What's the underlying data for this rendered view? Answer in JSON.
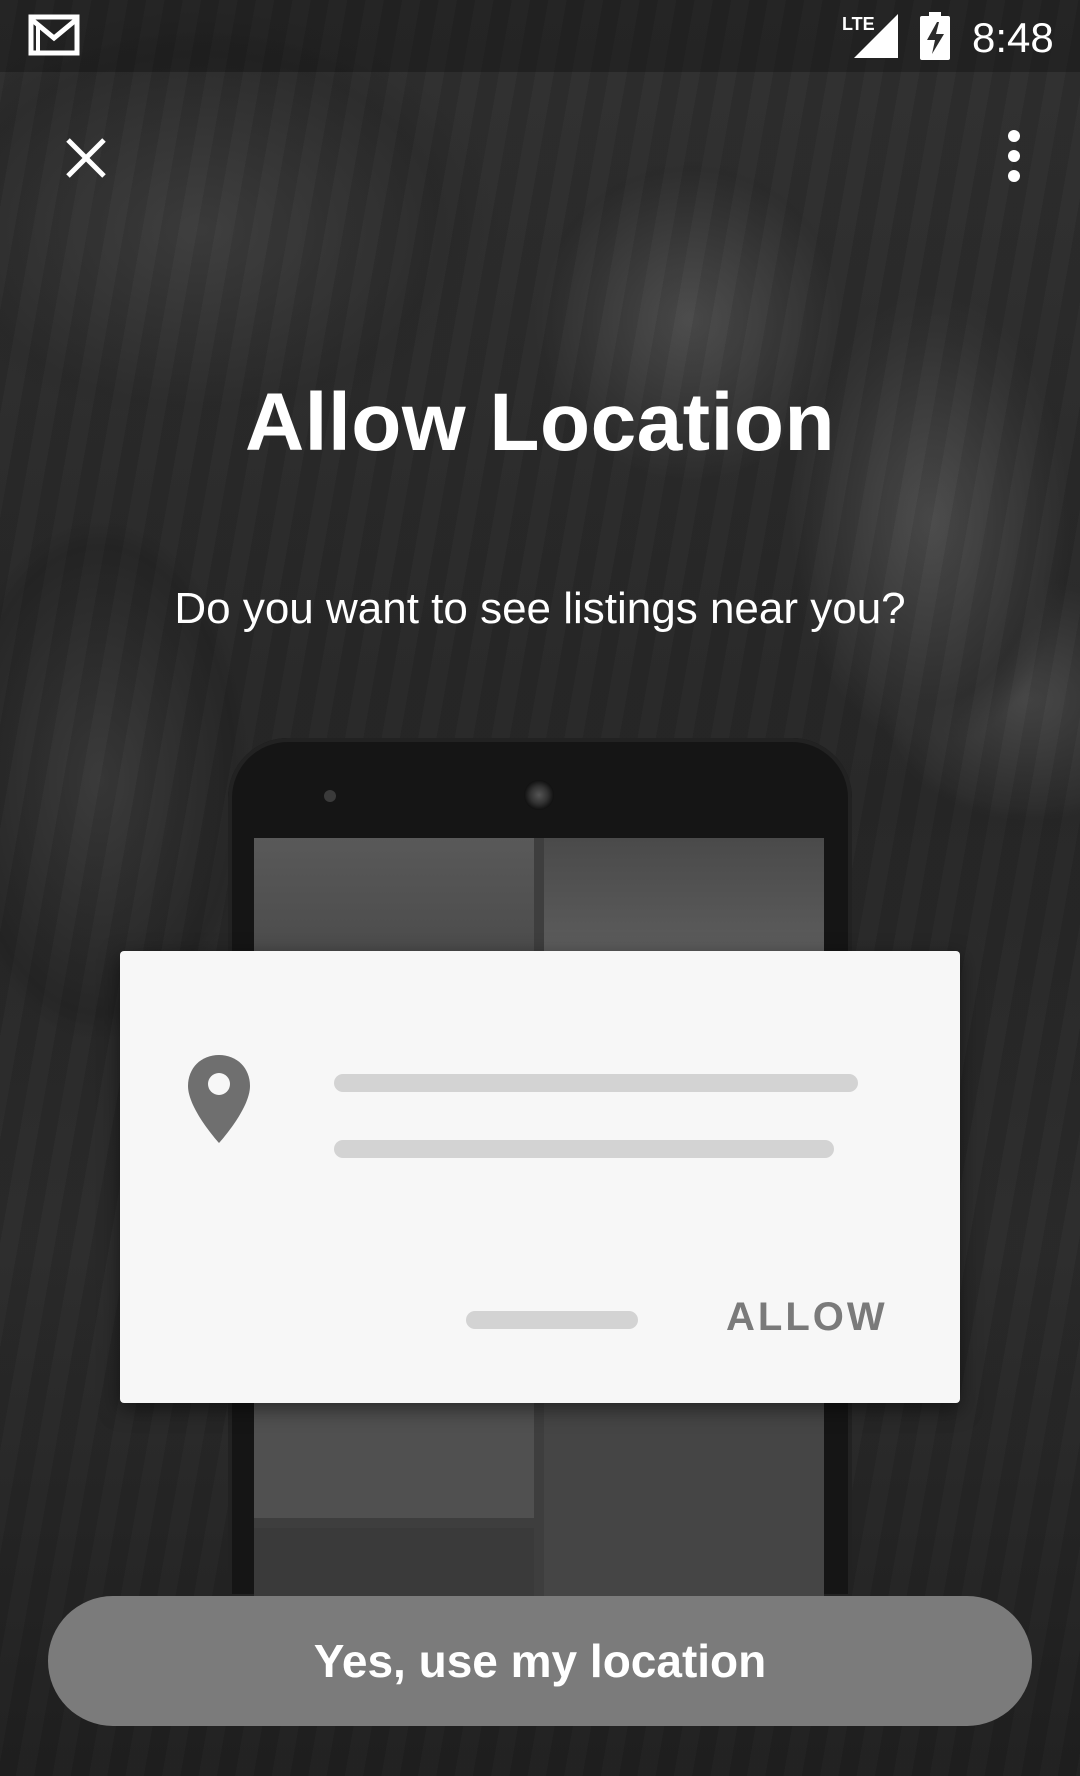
{
  "status_bar": {
    "time": "8:48",
    "network_label": "LTE",
    "icons": [
      "gmail-icon",
      "lte-signal-icon",
      "battery-charging-icon"
    ]
  },
  "toolbar": {
    "icons": [
      "close-icon",
      "more-vert-icon"
    ]
  },
  "title": "Allow Location",
  "subtitle": "Do you want to see listings near you?",
  "illustration": {
    "dialog_action_label": "ALLOW",
    "dialog_icon": "location-pin-icon"
  },
  "primary_button": {
    "label": "Yes, use my location"
  },
  "colors": {
    "button_background": "#7b7b7b",
    "card_background": "#f7f7f7",
    "skeleton": "#d3d3d3",
    "pin": "#6f6f6f",
    "allow_text": "#7a7a7a"
  }
}
